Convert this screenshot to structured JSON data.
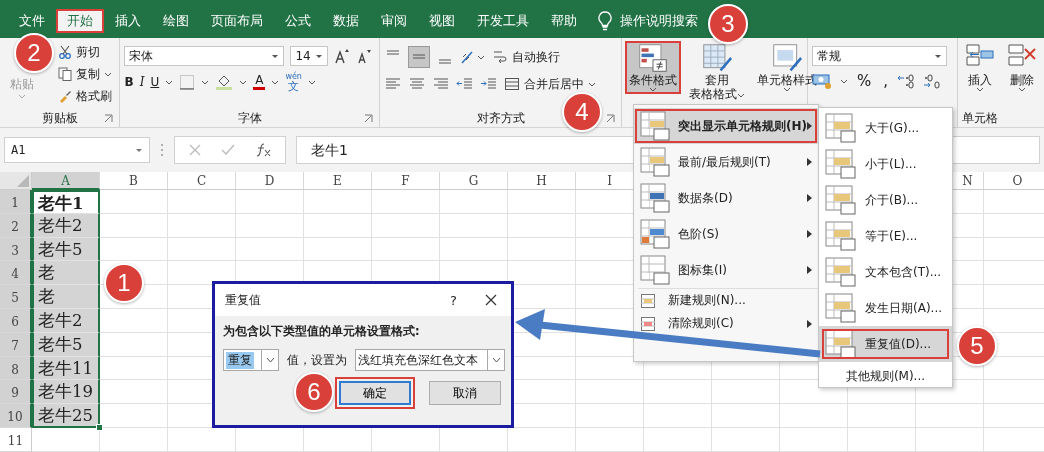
{
  "tabs": [
    {
      "label": "文件",
      "selected": false,
      "highlighted": false
    },
    {
      "label": "开始",
      "selected": true,
      "highlighted": true
    },
    {
      "label": "插入",
      "selected": false,
      "highlighted": false
    },
    {
      "label": "绘图",
      "selected": false,
      "highlighted": false
    },
    {
      "label": "页面布局",
      "selected": false,
      "highlighted": false
    },
    {
      "label": "公式",
      "selected": false,
      "highlighted": false
    },
    {
      "label": "数据",
      "selected": false,
      "highlighted": false
    },
    {
      "label": "审阅",
      "selected": false,
      "highlighted": false
    },
    {
      "label": "视图",
      "selected": false,
      "highlighted": false
    },
    {
      "label": "开发工具",
      "selected": false,
      "highlighted": false
    },
    {
      "label": "帮助",
      "selected": false,
      "highlighted": false
    }
  ],
  "search": {
    "label": "操作说明搜索"
  },
  "clipboard": {
    "paste": "粘贴",
    "cut": "剪切",
    "copy": "复制",
    "painter": "格式刷",
    "label": "剪贴板"
  },
  "font": {
    "name": "宋体",
    "size": "14",
    "bold": "B",
    "italic": "I",
    "underline": "U",
    "color_letter": "A",
    "phonetic_top": "wén",
    "phonetic_bottom": "文",
    "label": "字体"
  },
  "alignment": {
    "wrap": "自动换行",
    "merge": "合并后居中",
    "label": "对齐方式"
  },
  "styles": {
    "conditional": {
      "label": "条件格式",
      "expanded": true,
      "highlighted": true
    },
    "table_line_1": "套用",
    "table_line_2": "表格格式",
    "cell_styles": "单元格样式"
  },
  "number": {
    "format": "常规",
    "percent": "%",
    "comma": ","
  },
  "cells": {
    "insert": "插入",
    "delete": "删除",
    "label": "单元格"
  },
  "formula_bar": {
    "name_box": "A1",
    "content": "老牛1"
  },
  "sheet": {
    "columns": [
      {
        "label": "A",
        "selected": true
      },
      {
        "label": "B",
        "selected": false
      },
      {
        "label": "C",
        "selected": false
      },
      {
        "label": "D",
        "selected": false
      },
      {
        "label": "E",
        "selected": false
      },
      {
        "label": "F",
        "selected": false
      },
      {
        "label": "G",
        "selected": false
      },
      {
        "label": "H",
        "selected": false
      },
      {
        "label": "I",
        "selected": false
      }
    ],
    "columns_right": [
      {
        "label": "N",
        "selected": false
      },
      {
        "label": "O",
        "selected": false
      }
    ],
    "rows": [
      {
        "number": "1",
        "value": "老牛1",
        "selected": true,
        "active": true
      },
      {
        "number": "2",
        "value": "老牛2",
        "selected": true,
        "active": false
      },
      {
        "number": "3",
        "value": "老牛5",
        "selected": true,
        "active": false
      },
      {
        "number": "4",
        "value": "老",
        "selected": true,
        "active": false
      },
      {
        "number": "5",
        "value": "老",
        "selected": true,
        "active": false
      },
      {
        "number": "6",
        "value": "老牛2",
        "selected": true,
        "active": false
      },
      {
        "number": "7",
        "value": "老牛5",
        "selected": true,
        "active": false
      },
      {
        "number": "8",
        "value": "老牛11",
        "selected": true,
        "active": false
      },
      {
        "number": "9",
        "value": "老牛19",
        "selected": true,
        "active": false
      },
      {
        "number": "10",
        "value": "老牛25",
        "selected": true,
        "active": false
      },
      {
        "number": "11",
        "value": "",
        "selected": false,
        "active": false
      }
    ]
  },
  "menu": {
    "items": [
      {
        "label": "突出显示单元格规则(H)",
        "kind": "large",
        "submenu": true,
        "highlighted": true
      },
      {
        "label": "最前/最后规则(T)",
        "kind": "large",
        "submenu": true,
        "highlighted": false
      },
      {
        "label": "数据条(D)",
        "kind": "large",
        "submenu": true,
        "highlighted": false
      },
      {
        "label": "色阶(S)",
        "kind": "large",
        "submenu": true,
        "highlighted": false
      },
      {
        "label": "图标集(I)",
        "kind": "large",
        "submenu": true,
        "highlighted": false
      },
      {
        "label": "新建规则(N)...",
        "kind": "small",
        "submenu": false,
        "highlighted": false
      },
      {
        "label": "清除规则(C)",
        "kind": "small",
        "submenu": true,
        "highlighted": false
      }
    ]
  },
  "submenu": {
    "items": [
      {
        "label": "大于(G)...",
        "kind": "icon",
        "highlighted": false
      },
      {
        "label": "小于(L)...",
        "kind": "icon",
        "highlighted": false
      },
      {
        "label": "介于(B)...",
        "kind": "icon",
        "highlighted": false
      },
      {
        "label": "等于(E)...",
        "kind": "icon",
        "highlighted": false
      },
      {
        "label": "文本包含(T)...",
        "kind": "icon",
        "highlighted": false
      },
      {
        "label": "发生日期(A)...",
        "kind": "icon",
        "highlighted": false
      },
      {
        "label": "重复值(D)...",
        "kind": "icon",
        "highlighted": true
      },
      {
        "label": "其他规则(M)...",
        "kind": "plain",
        "highlighted": false
      }
    ]
  },
  "dialog": {
    "title": "重复值",
    "help": "?",
    "prompt": "为包含以下类型值的单元格设置格式:",
    "type_value": "重复",
    "middle_label": "值，设置为",
    "format_value": "浅红填充色深红色文本",
    "buttons": [
      {
        "label": "确定",
        "highlighted": true
      },
      {
        "label": "取消",
        "highlighted": false
      }
    ]
  },
  "callouts": [
    "1",
    "2",
    "3",
    "4",
    "5",
    "6"
  ]
}
